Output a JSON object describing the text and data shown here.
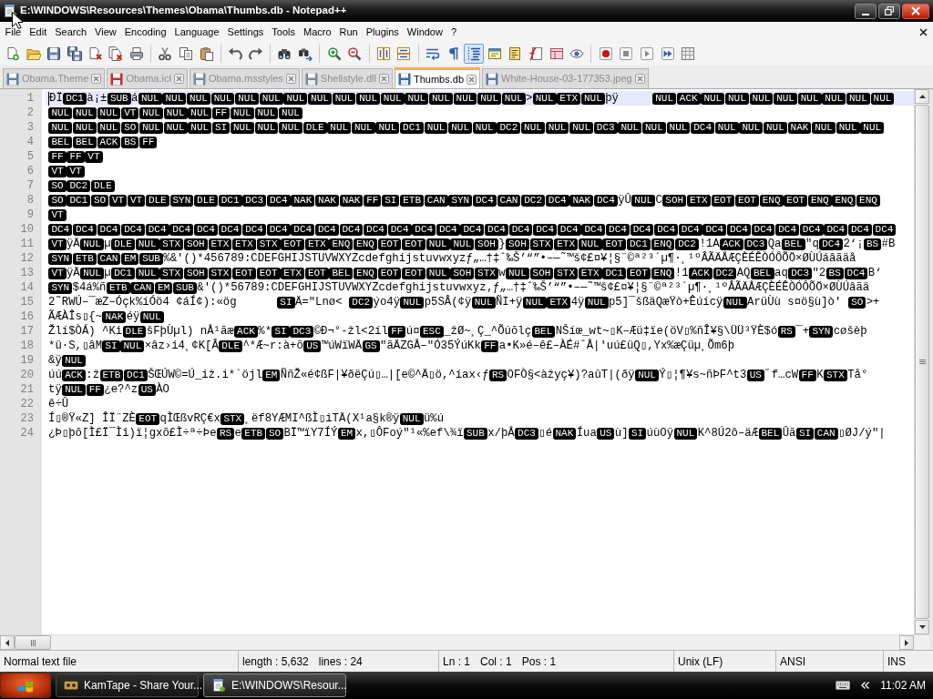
{
  "window": {
    "title": "E:\\WINDOWS\\Resources\\Themes\\Obama\\Thumbs.db - Notepad++"
  },
  "menu": [
    "File",
    "Edit",
    "Search",
    "View",
    "Encoding",
    "Language",
    "Settings",
    "Tools",
    "Macro",
    "Run",
    "Plugins",
    "Window",
    "?"
  ],
  "toolbar": [
    [
      {
        "kind": "new",
        "pressed": false
      },
      {
        "kind": "open",
        "pressed": false
      },
      {
        "kind": "save",
        "pressed": false
      },
      {
        "kind": "save_all",
        "pressed": false
      },
      {
        "kind": "close",
        "pressed": false
      },
      {
        "kind": "close_all",
        "pressed": false
      },
      {
        "kind": "print",
        "pressed": false
      }
    ],
    [
      {
        "kind": "cut",
        "pressed": false
      },
      {
        "kind": "copy",
        "pressed": false
      },
      {
        "kind": "paste",
        "pressed": false
      }
    ],
    [
      {
        "kind": "undo",
        "pressed": false
      },
      {
        "kind": "redo",
        "pressed": false
      }
    ],
    [
      {
        "kind": "find",
        "pressed": false
      },
      {
        "kind": "replace",
        "pressed": false
      }
    ],
    [
      {
        "kind": "zoom_in",
        "pressed": false
      },
      {
        "kind": "zoom_out",
        "pressed": false
      }
    ],
    [
      {
        "kind": "sync_v",
        "pressed": false
      },
      {
        "kind": "sync_h",
        "pressed": false
      }
    ],
    [
      {
        "kind": "wrap",
        "pressed": false
      },
      {
        "kind": "all_chars",
        "pressed": false
      },
      {
        "kind": "indent_guide",
        "pressed": true
      },
      {
        "kind": "lang",
        "pressed": false
      },
      {
        "kind": "doc_map",
        "pressed": false
      },
      {
        "kind": "func_list",
        "pressed": false
      },
      {
        "kind": "panel",
        "pressed": false
      },
      {
        "kind": "monitor",
        "pressed": false
      }
    ],
    [
      {
        "kind": "record",
        "pressed": false
      },
      {
        "kind": "stop",
        "pressed": false
      },
      {
        "kind": "play",
        "pressed": false
      },
      {
        "kind": "play_multi",
        "pressed": false
      },
      {
        "kind": "save_macro",
        "pressed": false
      }
    ]
  ],
  "tabs": [
    {
      "label": "Obama.Theme",
      "selected": false,
      "color": "#6a7c98"
    },
    {
      "label": "Obama.icl",
      "selected": false,
      "color": "#c03030"
    },
    {
      "label": "Obama.msstyles",
      "selected": false,
      "color": "#808890"
    },
    {
      "label": "Shellstyle.dll",
      "selected": false,
      "color": "#808890"
    },
    {
      "label": "Thumbs.db",
      "selected": true,
      "color": "#3a6ab0"
    },
    {
      "label": "White-House-03-177353.jpeg",
      "selected": false,
      "color": "#6a7c98"
    }
  ],
  "editor": {
    "lines": [
      {
        "number": "1",
        "current": true,
        "segments": [
          {
            "kind": "text",
            "text": "ÐÏ"
          },
          {
            "kind": "ctrl",
            "codes": [
              "DC1"
            ]
          },
          {
            "kind": "text",
            "text": "à¡±"
          },
          {
            "kind": "ctrl",
            "codes": [
              "SUB"
            ]
          },
          {
            "kind": "text",
            "text": "á"
          },
          {
            "kind": "ctrl",
            "codes": [
              "NUL",
              "NUL",
              "NUL",
              "NUL",
              "NUL",
              "NUL",
              "NUL",
              "NUL",
              "NUL",
              "NUL",
              "NUL",
              "NUL",
              "NUL",
              "NUL",
              "NUL",
              "NUL"
            ]
          },
          {
            "kind": "text",
            "text": ">"
          },
          {
            "kind": "ctrl",
            "codes": [
              "NUL",
              "ETX",
              "NUL"
            ]
          },
          {
            "kind": "text",
            "text": "þÿ     "
          },
          {
            "kind": "ctrl",
            "codes": [
              "NUL",
              "ACK",
              "NUL",
              "NUL",
              "NUL",
              "NUL",
              "NUL",
              "NUL",
              "NUL",
              "NUL"
            ]
          }
        ]
      },
      {
        "number": "2",
        "current": false,
        "segments": [
          {
            "kind": "ctrl",
            "codes": [
              "NUL",
              "NUL",
              "NUL",
              "VT",
              "NUL",
              "NUL",
              "NUL",
              "FF",
              "NUL",
              "NUL",
              "NUL"
            ]
          }
        ]
      },
      {
        "number": "3",
        "current": false,
        "segments": [
          {
            "kind": "ctrl",
            "codes": [
              "NUL",
              "NUL",
              "NUL",
              "SO",
              "NUL",
              "NUL",
              "NUL",
              "SI",
              "NUL",
              "NUL",
              "NUL",
              "DLE",
              "NUL",
              "NUL",
              "NUL",
              "DC1",
              "NUL",
              "NUL",
              "NUL",
              "DC2",
              "NUL",
              "NUL",
              "NUL",
              "DC3",
              "NUL",
              "NUL",
              "NUL",
              "DC4",
              "NUL",
              "NUL",
              "NUL",
              "NAK",
              "NUL",
              "NUL",
              "NUL"
            ]
          }
        ]
      },
      {
        "number": "4",
        "current": false,
        "segments": [
          {
            "kind": "ctrl",
            "codes": [
              "BEL",
              "BEL",
              "ACK",
              "BS",
              "FF"
            ]
          }
        ]
      },
      {
        "number": "5",
        "current": false,
        "segments": [
          {
            "kind": "ctrl",
            "codes": [
              "FF",
              "FF",
              "VT"
            ]
          }
        ]
      },
      {
        "number": "6",
        "current": false,
        "segments": [
          {
            "kind": "ctrl",
            "codes": [
              "VT",
              "VT"
            ]
          }
        ]
      },
      {
        "number": "7",
        "current": false,
        "segments": [
          {
            "kind": "ctrl",
            "codes": [
              "SO",
              "DC2",
              "DLE"
            ]
          }
        ]
      },
      {
        "number": "8",
        "current": false,
        "segments": [
          {
            "kind": "ctrl",
            "codes": [
              "SO",
              "DC1",
              "SO",
              "VT",
              "VT",
              "DLE",
              "SYN",
              "DLE",
              "DC1",
              "DC3",
              "DC4",
              "NAK",
              "NAK",
              "NAK",
              "FF",
              "SI",
              "ETB",
              "CAN",
              "SYN",
              "DC4",
              "CAN",
              "DC2",
              "DC4",
              "NAK",
              "DC4"
            ]
          },
          {
            "kind": "text",
            "text": "ÿÛ"
          },
          {
            "kind": "ctrl",
            "codes": [
              "NUL"
            ]
          },
          {
            "kind": "text",
            "text": "C"
          },
          {
            "kind": "ctrl",
            "codes": [
              "SOH",
              "ETX",
              "EOT",
              "EOT",
              "ENQ",
              "EOT",
              "ENQ",
              "ENQ",
              "ENQ"
            ]
          }
        ]
      },
      {
        "number": "9",
        "current": false,
        "segments": [
          {
            "kind": "ctrl",
            "codes": [
              "VT"
            ]
          }
        ]
      },
      {
        "number": "10",
        "current": false,
        "segments": [
          {
            "kind": "ctrl",
            "codes": [
              "DC4",
              "DC4",
              "DC4",
              "DC4",
              "DC4",
              "DC4",
              "DC4",
              "DC4",
              "DC4",
              "DC4",
              "DC4",
              "DC4",
              "DC4",
              "DC4",
              "DC4",
              "DC4",
              "DC4",
              "DC4",
              "DC4",
              "DC4",
              "DC4",
              "DC4",
              "DC4",
              "DC4",
              "DC4",
              "DC4",
              "DC4",
              "DC4",
              "DC4",
              "DC4",
              "DC4",
              "DC4",
              "DC4",
              "DC4",
              "DC4"
            ]
          }
        ]
      },
      {
        "number": "11",
        "current": false,
        "segments": [
          {
            "kind": "ctrl",
            "codes": [
              "VT"
            ]
          },
          {
            "kind": "text",
            "text": "ÿÄ"
          },
          {
            "kind": "ctrl",
            "codes": [
              "NUL"
            ]
          },
          {
            "kind": "text",
            "text": "µ"
          },
          {
            "kind": "ctrl",
            "codes": [
              "DLE",
              "NUL",
              "STX",
              "SOH",
              "ETX",
              "ETX",
              "STX",
              "EOT",
              "ETX",
              "ENQ",
              "ENQ",
              "EOT",
              "EOT",
              "NUL",
              "NUL",
              "SOH"
            ]
          },
          {
            "kind": "text",
            "text": "}"
          },
          {
            "kind": "ctrl",
            "codes": [
              "SOH",
              "STX",
              "ETX",
              "NUL",
              "EOT",
              "DC1",
              "ENQ",
              "DC2"
            ]
          },
          {
            "kind": "text",
            "text": "!1A"
          },
          {
            "kind": "ctrl",
            "codes": [
              "ACK",
              "DC3"
            ]
          },
          {
            "kind": "text",
            "text": "Qa"
          },
          {
            "kind": "ctrl",
            "codes": [
              "BEL"
            ]
          },
          {
            "kind": "text",
            "text": "\"q"
          },
          {
            "kind": "ctrl",
            "codes": [
              "DC4"
            ]
          },
          {
            "kind": "text",
            "text": "2‘¡"
          },
          {
            "kind": "ctrl",
            "codes": [
              "BS"
            ]
          },
          {
            "kind": "text",
            "text": "#B"
          }
        ]
      },
      {
        "number": "12",
        "current": false,
        "segments": [
          {
            "kind": "ctrl",
            "codes": [
              "SYN",
              "ETB",
              "CAN",
              "EM",
              "SUB"
            ]
          },
          {
            "kind": "text",
            "text": "%&'()*456789:CDEFGHIJSTUVWXYZcdefghijstuvwxyzƒ„…†‡ˆ‰Š’“”•–—˜™š¢£¤¥¦§¨©ª²³´µ¶·¸¹ºÂÃÄÅÆÇÈÉÊÒÓÔÕÖ×ØÙÚáâãäå"
          }
        ]
      },
      {
        "number": "13",
        "current": false,
        "segments": [
          {
            "kind": "ctrl",
            "codes": [
              "VT"
            ]
          },
          {
            "kind": "text",
            "text": "ÿÄ"
          },
          {
            "kind": "ctrl",
            "codes": [
              "NUL"
            ]
          },
          {
            "kind": "text",
            "text": "µ"
          },
          {
            "kind": "ctrl",
            "codes": [
              "DC1",
              "NUL",
              "STX",
              "SOH",
              "STX",
              "EOT",
              "EOT",
              "ETX",
              "EOT",
              "BEL",
              "ENQ",
              "EOT",
              "EOT",
              "NUL",
              "SOH",
              "STX"
            ]
          },
          {
            "kind": "text",
            "text": "w"
          },
          {
            "kind": "ctrl",
            "codes": [
              "NUL",
              "SOH",
              "STX",
              "ETX",
              "DC1",
              "EOT",
              "ENQ"
            ]
          },
          {
            "kind": "text",
            "text": "!1"
          },
          {
            "kind": "ctrl",
            "codes": [
              "ACK",
              "DC2"
            ]
          },
          {
            "kind": "text",
            "text": "AQ"
          },
          {
            "kind": "ctrl",
            "codes": [
              "BEL"
            ]
          },
          {
            "kind": "text",
            "text": "aq"
          },
          {
            "kind": "ctrl",
            "codes": [
              "DC3"
            ]
          },
          {
            "kind": "text",
            "text": "\"2"
          },
          {
            "kind": "ctrl",
            "codes": [
              "BS",
              "DC4"
            ]
          },
          {
            "kind": "text",
            "text": "B‘"
          }
        ]
      },
      {
        "number": "14",
        "current": false,
        "segments": [
          {
            "kind": "ctrl",
            "codes": [
              "SYN"
            ]
          },
          {
            "kind": "text",
            "text": "$4á%ñ"
          },
          {
            "kind": "ctrl",
            "codes": [
              "ETB",
              "CAN",
              "EM",
              "SUB"
            ]
          },
          {
            "kind": "text",
            "text": "&'()*56789:CDEFGHIJSTUVWXYZcdefghijstuvwxyz‚ƒ„…†‡ˆ‰Š’“”•–—˜™š¢£¤¥¦§¨©ª²³´µ¶·¸¹ºÂÃÄÅÆÇÈÉÊÒÓÔÕÖ×ØÙÚâãä"
          }
        ]
      },
      {
        "number": "15",
        "current": false,
        "segments": [
          {
            "kind": "text",
            "text": "2˜RWÚ–¯æZ–Óçk%íÓö4 ¢áÍ¢):«ög      "
          },
          {
            "kind": "ctrl",
            "codes": [
              "SI"
            ]
          },
          {
            "kind": "text",
            "text": "Ä=\"Lnø< "
          },
          {
            "kind": "ctrl",
            "codes": [
              "DC2"
            ]
          },
          {
            "kind": "text",
            "text": "ýo4ÿ"
          },
          {
            "kind": "ctrl",
            "codes": [
              "NUL"
            ]
          },
          {
            "kind": "text",
            "text": "p5SÂ(¢ÿ"
          },
          {
            "kind": "ctrl",
            "codes": [
              "NUL"
            ]
          },
          {
            "kind": "text",
            "text": "ÑI+ÿ"
          },
          {
            "kind": "ctrl",
            "codes": [
              "NUL",
              "ETX"
            ]
          },
          {
            "kind": "text",
            "text": "4ÿ"
          },
          {
            "kind": "ctrl",
            "codes": [
              "NUL"
            ]
          },
          {
            "kind": "text",
            "text": "p5]¯šßäQæŸò+Êúícÿ"
          },
          {
            "kind": "ctrl",
            "codes": [
              "NUL"
            ]
          },
          {
            "kind": "text",
            "text": "ArüÙù s¤ö§ù]ò' "
          },
          {
            "kind": "ctrl",
            "codes": [
              "SO"
            ]
          },
          {
            "kind": "text",
            "text": ">+"
          }
        ]
      },
      {
        "number": "16",
        "current": false,
        "segments": [
          {
            "kind": "text",
            "text": "ÃÆÀÎs▯{~"
          },
          {
            "kind": "ctrl",
            "codes": [
              "NAK"
            ]
          },
          {
            "kind": "text",
            "text": "éÿ"
          },
          {
            "kind": "ctrl",
            "codes": [
              "NUL"
            ]
          }
        ]
      },
      {
        "number": "17",
        "current": false,
        "segments": [
          {
            "kind": "text",
            "text": "Žlí$ÒÁ) ^Ki"
          },
          {
            "kind": "ctrl",
            "codes": [
              "DLE"
            ]
          },
          {
            "kind": "text",
            "text": "šFþÙµl) nÅ¹ãæ"
          },
          {
            "kind": "ctrl",
            "codes": [
              "ACK"
            ]
          },
          {
            "kind": "text",
            "text": "%*"
          },
          {
            "kind": "ctrl",
            "codes": [
              "SI",
              "DC3"
            ]
          },
          {
            "kind": "text",
            "text": "©Ð¬°-žl<2íl"
          },
          {
            "kind": "ctrl",
            "codes": [
              "FF"
            ]
          },
          {
            "kind": "text",
            "text": "ú¤"
          },
          {
            "kind": "ctrl",
            "codes": [
              "ESC"
            ]
          },
          {
            "kind": "text",
            "text": "_žØ~¸Ç_^Õúõlç"
          },
          {
            "kind": "ctrl",
            "codes": [
              "BEL"
            ]
          },
          {
            "kind": "text",
            "text": "NŠíœ_wt~▯K–Æü‡ïe(öV▯%ñÎ¥§\\ÜÜ³ŸÈ$ó"
          },
          {
            "kind": "ctrl",
            "codes": [
              "RS"
            ]
          },
          {
            "kind": "text",
            "text": "¯+"
          },
          {
            "kind": "ctrl",
            "codes": [
              "SYN"
            ]
          },
          {
            "kind": "text",
            "text": "cøšèþ"
          }
        ]
      },
      {
        "number": "18",
        "current": false,
        "segments": [
          {
            "kind": "text",
            "text": "*ü·S,▯âM"
          },
          {
            "kind": "ctrl",
            "codes": [
              "SI",
              "NUL"
            ]
          },
          {
            "kind": "text",
            "text": "×âz›i4¸¢K[Â"
          },
          {
            "kind": "ctrl",
            "codes": [
              "DLE"
            ]
          },
          {
            "kind": "text",
            "text": "^*Æ~r:à+õ"
          },
          {
            "kind": "ctrl",
            "codes": [
              "US"
            ]
          },
          {
            "kind": "text",
            "text": "™úWïWÄ"
          },
          {
            "kind": "ctrl",
            "codes": [
              "GS"
            ]
          },
          {
            "kind": "text",
            "text": "\"ãÄZGÅ–\"Ó35ÝúKk"
          },
          {
            "kind": "ctrl",
            "codes": [
              "FF"
            ]
          },
          {
            "kind": "text",
            "text": "a•K»é–ê£–ÀÉ#ˆÅ|'uú£üQ▯,Yx%æÇüµ¸Õm6þ"
          }
        ]
      },
      {
        "number": "19",
        "current": false,
        "segments": [
          {
            "kind": "text",
            "text": "&ÿ"
          },
          {
            "kind": "ctrl",
            "codes": [
              "NUL"
            ]
          }
        ]
      },
      {
        "number": "20",
        "current": false,
        "segments": [
          {
            "kind": "text",
            "text": "úú"
          },
          {
            "kind": "ctrl",
            "codes": [
              "ACK"
            ]
          },
          {
            "kind": "text",
            "text": ":ž"
          },
          {
            "kind": "ctrl",
            "codes": [
              "ETB",
              "DC1"
            ]
          },
          {
            "kind": "text",
            "text": "ŠŒÚW©=Ú_iž.i*`öjl"
          },
          {
            "kind": "ctrl",
            "codes": [
              "EM"
            ]
          },
          {
            "kind": "text",
            "text": "ÑñŽ«é¢ßF|¥ðëÇú▯…|[e©^Ä▯ö,^íax‹ƒ"
          },
          {
            "kind": "ctrl",
            "codes": [
              "RS"
            ]
          },
          {
            "kind": "text",
            "text": "OFÒ§<àžyç¥)?aûT|(ðÿ"
          },
          {
            "kind": "ctrl",
            "codes": [
              "NUL"
            ]
          },
          {
            "kind": "text",
            "text": "Ý▯¦¶¥s~ñÞF^t3"
          },
          {
            "kind": "ctrl",
            "codes": [
              "US"
            ]
          },
          {
            "kind": "text",
            "text": "˝f…cW"
          },
          {
            "kind": "ctrl",
            "codes": [
              "FF"
            ]
          },
          {
            "kind": "text",
            "text": "K"
          },
          {
            "kind": "ctrl",
            "codes": [
              "STX"
            ]
          },
          {
            "kind": "text",
            "text": "Tå°"
          }
        ]
      },
      {
        "number": "21",
        "current": false,
        "segments": [
          {
            "kind": "text",
            "text": "tÿ"
          },
          {
            "kind": "ctrl",
            "codes": [
              "NUL",
              "FF"
            ]
          },
          {
            "kind": "text",
            "text": "¿e?^z"
          },
          {
            "kind": "ctrl",
            "codes": [
              "US"
            ]
          },
          {
            "kind": "text",
            "text": "ÀO"
          }
        ]
      },
      {
        "number": "22",
        "current": false,
        "segments": [
          {
            "kind": "text",
            "text": "ê÷Û"
          }
        ]
      },
      {
        "number": "23",
        "current": false,
        "segments": [
          {
            "kind": "text",
            "text": "Í▯®Ÿ«Z] ÎÏ¨ZÈ"
          },
          {
            "kind": "ctrl",
            "codes": [
              "EOT"
            ]
          },
          {
            "kind": "text",
            "text": "qÌŒßvRÇ€x"
          },
          {
            "kind": "ctrl",
            "codes": [
              "STX"
            ]
          },
          {
            "kind": "text",
            "text": "¸ëf8YÆMI^ßÌ▯iTÄ(X¹a§k®ÿ"
          },
          {
            "kind": "ctrl",
            "codes": [
              "NUL"
            ]
          },
          {
            "kind": "text",
            "text": "ü%ú"
          }
        ]
      },
      {
        "number": "24",
        "current": false,
        "segments": [
          {
            "kind": "text",
            "text": "¿Þ▯þõ[Ì£Ï¯Ìî)ï¦gxõ£Ì÷ª÷Þe"
          },
          {
            "kind": "ctrl",
            "codes": [
              "RS"
            ]
          },
          {
            "kind": "text",
            "text": "e"
          },
          {
            "kind": "ctrl",
            "codes": [
              "ETB",
              "SO"
            ]
          },
          {
            "kind": "text",
            "text": "BÏ™ïY7ÍÝ"
          },
          {
            "kind": "ctrl",
            "codes": [
              "EM"
            ]
          },
          {
            "kind": "text",
            "text": "x,▯ÔFoý\"¹«%ef\\¾ï"
          },
          {
            "kind": "ctrl",
            "codes": [
              "SUB"
            ]
          },
          {
            "kind": "text",
            "text": "x/þÅ"
          },
          {
            "kind": "ctrl",
            "codes": [
              "DC3"
            ]
          },
          {
            "kind": "text",
            "text": "▯é"
          },
          {
            "kind": "ctrl",
            "codes": [
              "NAK"
            ]
          },
          {
            "kind": "text",
            "text": "Íua"
          },
          {
            "kind": "ctrl",
            "codes": [
              "US"
            ]
          },
          {
            "kind": "text",
            "text": "ù]"
          },
          {
            "kind": "ctrl",
            "codes": [
              "SI"
            ]
          },
          {
            "kind": "text",
            "text": "úùOÿ"
          },
          {
            "kind": "ctrl",
            "codes": [
              "NUL"
            ]
          },
          {
            "kind": "text",
            "text": "K^8Ú2ô–äÆ"
          },
          {
            "kind": "ctrl",
            "codes": [
              "BEL"
            ]
          },
          {
            "kind": "text",
            "text": "Ûã"
          },
          {
            "kind": "ctrl",
            "codes": [
              "SI",
              "CAN"
            ]
          },
          {
            "kind": "text",
            "text": "▯ØJ/ý\"|"
          }
        ]
      }
    ]
  },
  "status_bar": [
    [
      "Normal text file"
    ],
    [
      "length : 5,632",
      "lines : 24"
    ],
    [
      "Ln : 1",
      "Col : 1",
      "Pos : 1"
    ],
    [
      "Unix (LF)"
    ],
    [
      "ANSI"
    ],
    [
      "INS"
    ]
  ],
  "taskbar": {
    "tasks": [
      {
        "label": "KamTape - Share Your...",
        "selected": false
      },
      {
        "label": "E:\\WINDOWS\\Resour...",
        "selected": true
      }
    ],
    "clock": "11:02 AM"
  }
}
